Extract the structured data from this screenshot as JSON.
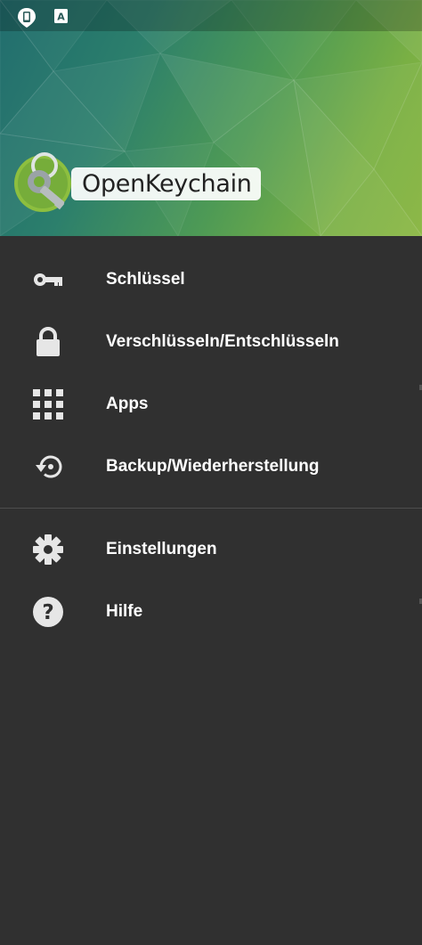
{
  "header": {
    "app_name": "OpenKeychain",
    "logo_icon": "key-logo-icon",
    "status_icons": [
      "phone-notification-icon",
      "a-keyboard-icon"
    ],
    "status_a_letter": "A"
  },
  "menu": {
    "primary": [
      {
        "label": "Schlüssel",
        "icon": "key-icon"
      },
      {
        "label": "Verschlüsseln/Entschlüsseln",
        "icon": "lock-icon"
      },
      {
        "label": "Apps",
        "icon": "apps-grid-icon"
      },
      {
        "label": "Backup/Wiederherstellung",
        "icon": "restore-icon"
      }
    ],
    "secondary": [
      {
        "label": "Einstellungen",
        "icon": "gear-icon"
      },
      {
        "label": "Hilfe",
        "icon": "help-icon"
      }
    ]
  },
  "colors": {
    "drawer_background": "#303030",
    "text": "#ffffff",
    "icon": "#e6e6e6",
    "header_teal": "#1d6b6c",
    "header_green": "#89b640"
  }
}
